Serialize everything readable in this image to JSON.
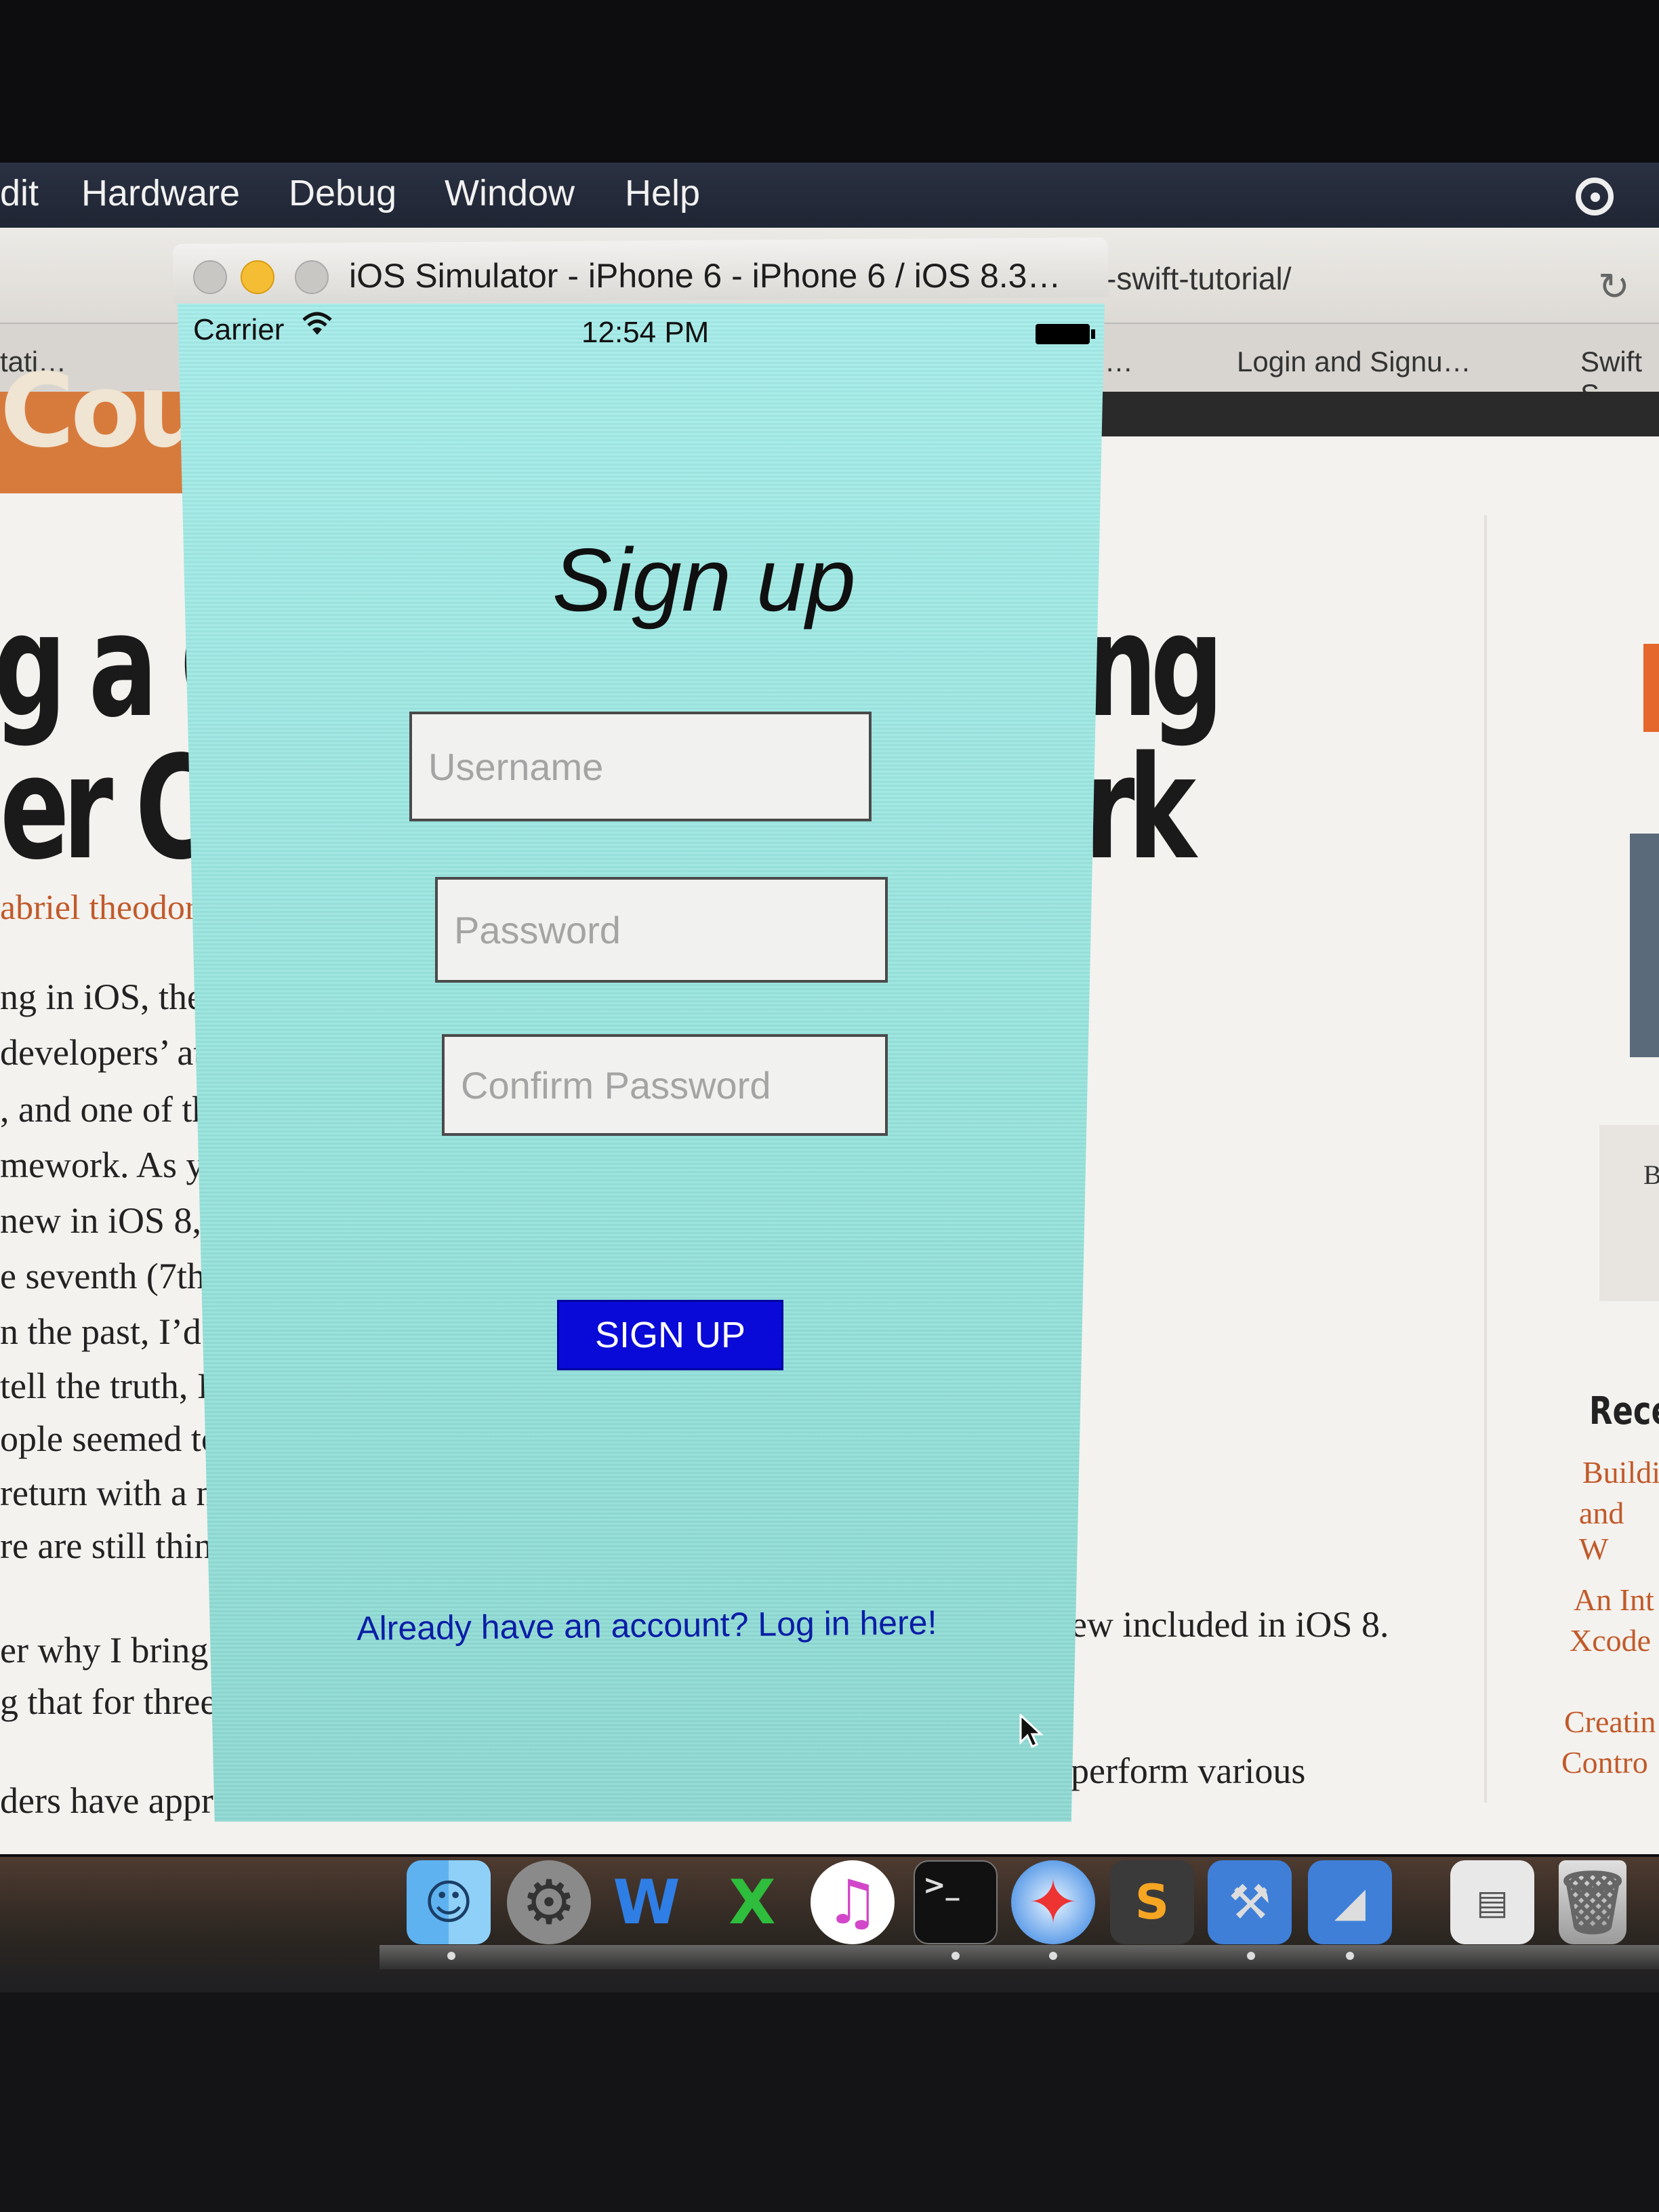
{
  "menubar": {
    "items": [
      "dit",
      "Hardware",
      "Debug",
      "Window",
      "Help"
    ]
  },
  "browser": {
    "url_fragment": "-swift-tutorial/",
    "tabs": [
      "tati…",
      "…",
      "Login and Signu…",
      "Swift S"
    ],
    "logo_text": "Cou",
    "headline_left": [
      "g a Cl",
      "er Co"
    ],
    "headline_right": [
      "ng",
      "rk"
    ],
    "author": "abriel theodoro",
    "body_lines": [
      "ng in iOS, the",
      "developers’ at",
      ", and one of th",
      "mework. As y",
      " new in iOS 8,",
      "e seventh (7th)",
      "n the past, I’d w",
      "tell the truth, I",
      "ople seemed to",
      "return with a ne",
      "re are still thing",
      "er why I bring to",
      "g that for three re",
      "ders have approa"
    ],
    "right_lines": [
      "ew included in iOS 8.",
      "perform various"
    ],
    "sidebar": {
      "recent_title": "Recen",
      "recent_links": [
        "Buildi",
        "and W",
        "An Int",
        "Xcode",
        "Creatin",
        "Contro"
      ],
      "small_label": "B"
    }
  },
  "simulator": {
    "window_title": "iOS Simulator - iPhone 6 - iPhone 6 / iOS 8.3…",
    "status": {
      "carrier": "Carrier",
      "time": "12:54 PM"
    },
    "screen": {
      "title": "Sign up",
      "username_placeholder": "Username",
      "password_placeholder": "Password",
      "confirm_placeholder": "Confirm Password",
      "signup_button": "SIGN UP",
      "login_link": "Already have an account? Log in here!"
    }
  },
  "dock": {
    "apps": [
      "finder-icon",
      "system-preferences-icon",
      "word-icon",
      "excel-icon",
      "itunes-icon",
      "terminal-icon",
      "safari-icon",
      "sublime-text-icon",
      "xcode-icon",
      "instruments-icon",
      "preview-icon",
      "trash-icon"
    ]
  },
  "colors": {
    "sim_background": "#9fe8e3",
    "signup_button": "#0a0ad8",
    "link": "#0a1da6",
    "accent_orange": "#c15a2b"
  }
}
